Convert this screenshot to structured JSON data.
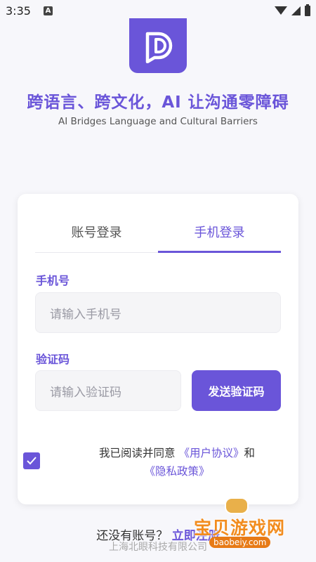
{
  "status_bar": {
    "time": "3:35",
    "notification_icon": "A"
  },
  "brand": {
    "logo_icon": "app-logo-icon",
    "accent_color": "#6a55d9",
    "headline": "跨语言、跨文化，AI 让沟通零障碍",
    "subheadline": "AI Bridges Language and Cultural Barriers"
  },
  "login": {
    "tabs": [
      {
        "label": "账号登录",
        "active": false
      },
      {
        "label": "手机登录",
        "active": true
      }
    ],
    "phone_label": "手机号",
    "phone_placeholder": "请输入手机号",
    "code_label": "验证码",
    "code_placeholder": "请输入验证码",
    "send_code_button": "发送验证码",
    "agreement": {
      "checked": true,
      "prefix": "我已阅读并同意",
      "user_agreement": "《用户协议》",
      "and": "和",
      "privacy_policy": "《隐私政策》"
    }
  },
  "footer": {
    "no_account": "还没有账号？",
    "register_link": "立即注册",
    "company": "上海北眼科技有限公司"
  },
  "watermark": {
    "title": "宝贝游戏网",
    "url": "baobeiy.com"
  }
}
